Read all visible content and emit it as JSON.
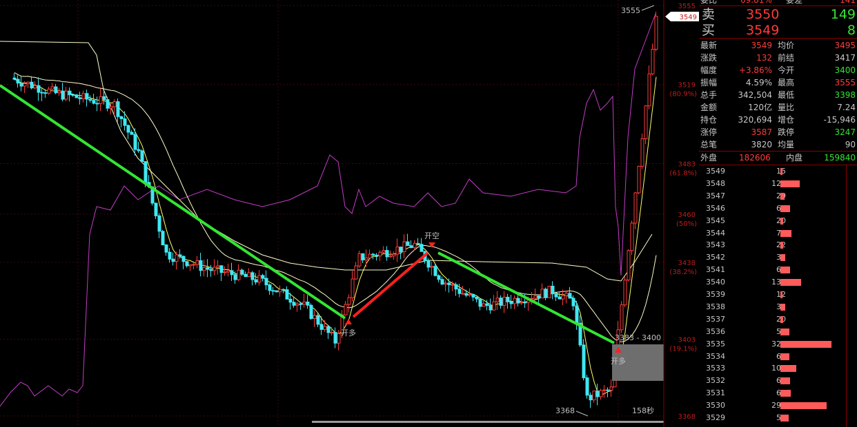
{
  "colors": {
    "background": "#000000",
    "grid": "#3a0c0c",
    "axis": "#8b0000",
    "up_candle": "#ff3b3b",
    "down_candle": "#3ee8f2",
    "trend_green": "#33e533",
    "trend_red": "#ff2020",
    "oi_line": "#c43cc8",
    "ma_short": "#ffff66",
    "ma_long": "#ffffcc",
    "text_label": "#c0c0c0",
    "axis_label": "#c01c1c",
    "bid_bar": "#ff5b5b"
  },
  "chart": {
    "price_top": 3555,
    "price_bottom": 3368,
    "current_price_tag": "3549",
    "high_label": "3555",
    "low_label": "3368",
    "range_label": "3383 - 3400",
    "countdown_label": "158秒",
    "signal_text": "开多",
    "signal_text_short": "开空",
    "axis_ticks": [
      {
        "value": 3555,
        "label": "3555",
        "pct": ""
      },
      {
        "value": 3519,
        "label": "3519",
        "pct": "(80.9%)"
      },
      {
        "value": 3483,
        "label": "3483",
        "pct": "(61.8%)"
      },
      {
        "value": 3460,
        "label": "3460",
        "pct": "(50%)"
      },
      {
        "value": 3438,
        "label": "3438",
        "pct": "(38.2%)"
      },
      {
        "value": 3403,
        "label": "3403",
        "pct": "(19.1%)"
      },
      {
        "value": 3368,
        "label": "3368",
        "pct": ""
      }
    ]
  },
  "quote": {
    "top_cut_left": "委比",
    "top_cut_val1": "69.81%",
    "top_cut_mid": "委差",
    "top_cut_val2": "141",
    "sell_label": "卖",
    "sell_price": "3550",
    "sell_vol": "149",
    "buy_label": "买",
    "buy_price": "3549",
    "buy_vol": "8",
    "rows": [
      {
        "l1": "最新",
        "v1": "3549",
        "l2": "均价",
        "v2": "3495",
        "c1": "#ff3b3b",
        "c2": "#ff3b3b"
      },
      {
        "l1": "涨跌",
        "v1": "132",
        "l2": "前结",
        "v2": "3417",
        "c1": "#ff3b3b",
        "c2": "#c8c8c8"
      },
      {
        "l1": "幅度",
        "v1": "+3.86%",
        "l2": "今开",
        "v2": "3400",
        "c1": "#ff3b3b",
        "c2": "#33e533"
      },
      {
        "l1": "振幅",
        "v1": "4.59%",
        "l2": "最高",
        "v2": "3555",
        "c1": "#c8c8c8",
        "c2": "#ff3b3b"
      },
      {
        "l1": "总手",
        "v1": "342,504",
        "l2": "最低",
        "v2": "3398",
        "c1": "#c8c8c8",
        "c2": "#33e533"
      },
      {
        "l1": "金额",
        "v1": "120亿",
        "l2": "量比",
        "v2": "7.24",
        "c1": "#c8c8c8",
        "c2": "#c8c8c8"
      },
      {
        "l1": "持仓",
        "v1": "320,694",
        "l2": "增仓",
        "v2": "-15,946",
        "c1": "#c8c8c8",
        "c2": "#c8c8c8"
      },
      {
        "l1": "涨停",
        "v1": "3587",
        "l2": "跌停",
        "v2": "3247",
        "c1": "#ff3b3b",
        "c2": "#33e533"
      },
      {
        "l1": "总笔",
        "v1": "3820",
        "l2": "均量",
        "v2": "90",
        "c1": "#c8c8c8",
        "c2": "#c8c8c8"
      }
    ],
    "outer_label": "外盘",
    "outer_val": "182606",
    "inner_label": "内盘",
    "inner_val": "159840"
  },
  "order_book": [
    {
      "price": "3549",
      "vol": "15",
      "frac": 0.02
    },
    {
      "price": "3548",
      "vol": "126",
      "frac": 0.38
    },
    {
      "price": "3547",
      "vol": "29",
      "frac": 0.08
    },
    {
      "price": "3546",
      "vol": "64",
      "frac": 0.19
    },
    {
      "price": "3545",
      "vol": "20",
      "frac": 0.05
    },
    {
      "price": "3544",
      "vol": "73",
      "frac": 0.22
    },
    {
      "price": "3543",
      "vol": "22",
      "frac": 0.06
    },
    {
      "price": "3542",
      "vol": "35",
      "frac": 0.1
    },
    {
      "price": "3541",
      "vol": "63",
      "frac": 0.19
    },
    {
      "price": "3540",
      "vol": "136",
      "frac": 0.41
    },
    {
      "price": "3539",
      "vol": "12",
      "frac": 0.02
    },
    {
      "price": "3538",
      "vol": "32",
      "frac": 0.09
    },
    {
      "price": "3537",
      "vol": "20",
      "frac": 0.05
    },
    {
      "price": "3536",
      "vol": "57",
      "frac": 0.17
    },
    {
      "price": "3535",
      "vol": "328",
      "frac": 1.0
    },
    {
      "price": "3534",
      "vol": "62",
      "frac": 0.18
    },
    {
      "price": "3533",
      "vol": "104",
      "frac": 0.31
    },
    {
      "price": "3532",
      "vol": "64",
      "frac": 0.19
    },
    {
      "price": "3531",
      "vol": "66",
      "frac": 0.2
    },
    {
      "price": "3530",
      "vol": "294",
      "frac": 0.9
    },
    {
      "price": "3529",
      "vol": "56",
      "frac": 0.16
    }
  ]
}
